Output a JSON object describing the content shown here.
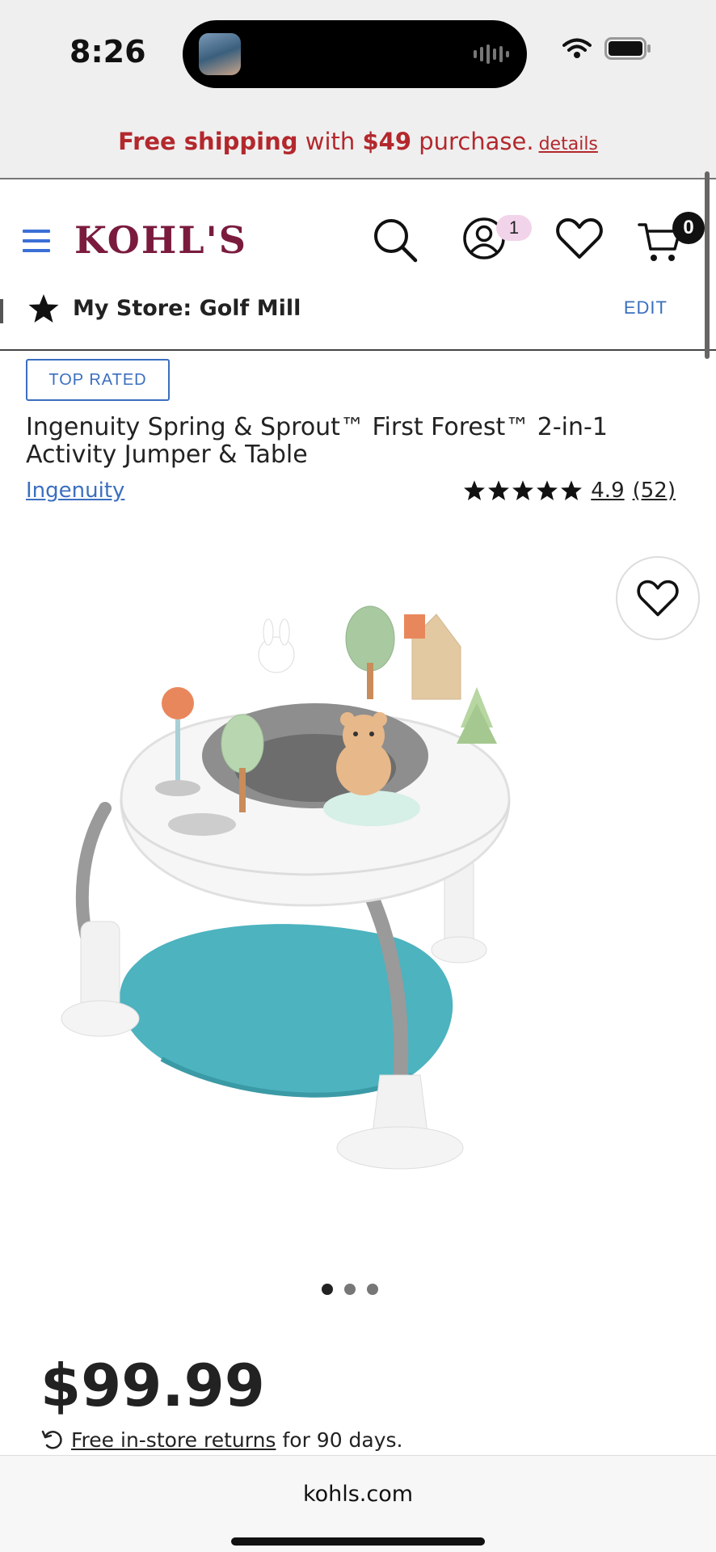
{
  "status_bar": {
    "time": "8:26"
  },
  "promo": {
    "free_shipping": "Free shipping",
    "with": " with ",
    "amount": "$49",
    "purchase": " purchase.",
    "details": "details"
  },
  "header": {
    "logo": "KOHL'S",
    "account_badge": "1",
    "cart_count": "0"
  },
  "store": {
    "label": "My Store: Golf Mill",
    "edit": "EDIT"
  },
  "product": {
    "badge": "TOP RATED",
    "title": "Ingenuity Spring & Sprout™ First Forest™ 2-in-1 Activity Jumper & Table",
    "brand": "Ingenuity",
    "rating": "4.9",
    "review_count": "(52)",
    "price": "$99.99",
    "returns_link": "Free in-store returns",
    "returns_text": " for 90 days.",
    "image_count": 3,
    "active_image": 1
  },
  "browser": {
    "url": "kohls.com"
  },
  "colors": {
    "brand": "#7a1b3e",
    "promo": "#b3282d",
    "link": "#3b6fbf"
  }
}
